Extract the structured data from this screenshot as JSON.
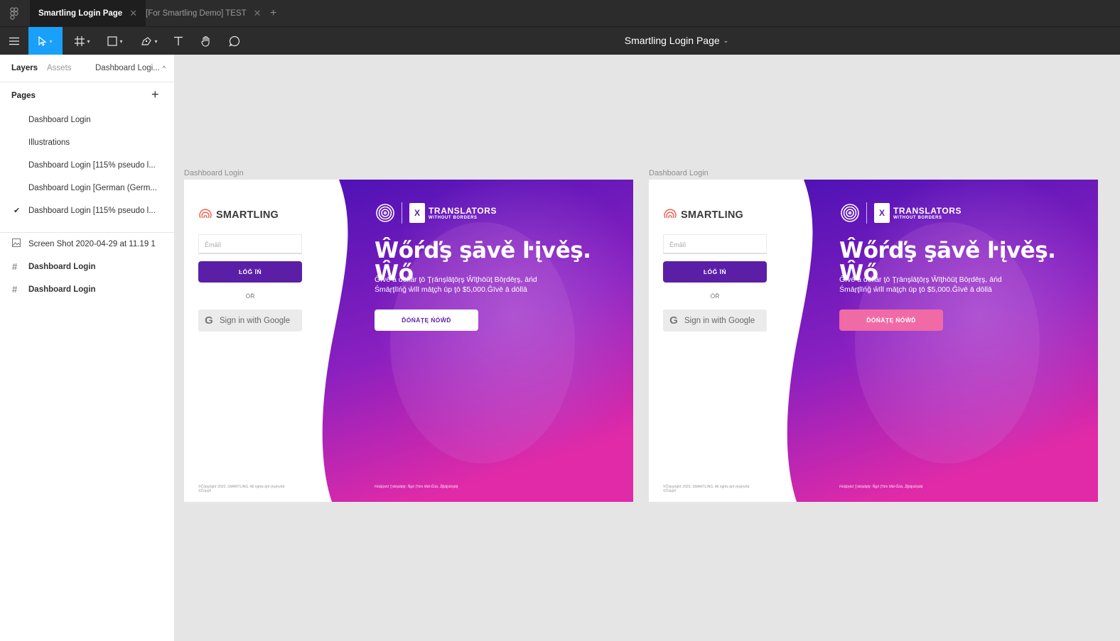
{
  "app": {
    "tabs": [
      {
        "label": "Smartling Login Page",
        "active": true
      },
      {
        "label": "[For Smartling Demo] TEST",
        "active": false
      }
    ],
    "document_title": "Smartling Login Page"
  },
  "toolbar": {
    "tools": [
      "menu-icon",
      "move-icon",
      "frame-icon",
      "rectangle-icon",
      "pen-icon",
      "text-icon",
      "hand-icon",
      "comment-icon"
    ]
  },
  "sidebar": {
    "tabs": {
      "layers": "Layers",
      "assets": "Assets",
      "current_page": "Dashboard Logi..."
    },
    "pages_heading": "Pages",
    "pages": [
      {
        "label": "Dashboard Login",
        "checked": false
      },
      {
        "label": "Illustrations",
        "checked": false
      },
      {
        "label": "Dashboard Login [115% pseudo l...",
        "checked": false
      },
      {
        "label": "Dashboard Login [German (Germ...",
        "checked": false
      },
      {
        "label": "Dashboard Login [115% pseudo l...",
        "checked": true
      }
    ],
    "layers": [
      {
        "label": "Screen Shot 2020-04-29 at 11.19 1",
        "icon": "image-icon"
      },
      {
        "label": "Dashboard Login",
        "icon": "frame-icon"
      },
      {
        "label": "Dashboard Login",
        "icon": "frame-icon"
      }
    ]
  },
  "frames": [
    {
      "label": "Dashboard Login",
      "brand": "SMARTLING",
      "email_placeholder": "Ēmāīl",
      "login_label": "ĿÓĞ ÏŃ",
      "or_label": "ÓŘ",
      "google_label": "Sign in with Google",
      "copyright": "©Ĉōpyŗīghť 2020, SMARTLING. All rights āŗē ŗēşēŗvēd ©Ĉöpÿŕì",
      "partner_line1": "TRANSLATORS",
      "partner_line2": "WITHOUT BORDERS",
      "partner_badge": "X",
      "headline": "Ŵőŕďş şāvě ŀįvěş. Ŵő",
      "body": "Ĝīvē ā dōllār ţō Ţŗānşlāţōŗş Ŵīţhōūţ Bōŗdēŗş, āńd Śmāŗţlīńğ ŵīll māţçh ūp ţō $5,000.Ĝīvē ā dōllā",
      "donate_label": "ĎÓŃÄŢĘ ŃÓŴĎ",
      "donate_bg": "#ffffff",
      "donate_fg": "#5b1ea7",
      "photo_credit": "Fēāţūŗēd Ţŗāńşlāţōŗ: Ňgō Ţhīm Māī-Ğūā, Ĵīğāţŗāńşlāţ"
    },
    {
      "label": "Dashboard Login",
      "brand": "SMARTLING",
      "email_placeholder": "Ēmāīl",
      "login_label": "ĿÓĞ ÏŃ",
      "or_label": "ÓŘ",
      "google_label": "Sign in with Google",
      "copyright": "©Ĉōpyŗīghť 2020, SMARTLING. All rights āŗē ŗēşēŗvēd ©Ĉöpÿŕì",
      "partner_line1": "TRANSLATORS",
      "partner_line2": "WITHOUT BORDERS",
      "partner_badge": "X",
      "headline": "Ŵőŕďş şāvě ŀįvěş. Ŵő",
      "body": "Ĝīvē ā dōllār ţō Ţŗānşlāţōŗş Ŵīţhōūţ Bōŗdēŗş, āńd Śmāŗţlīńğ ŵīll māţçh ūp ţō $5,000.Ĝīvē ā dōllā",
      "donate_label": "ĎÓŃÄŢĘ ŃÓŴĎ",
      "donate_bg": "#f06aa6",
      "donate_fg": "#ffffff",
      "photo_credit": "Fēāţūŗēd Ţŗāńşlāţōŗ: Ňgō Ţhīm Māī-Ğūā, Ĵīğāţŗāńşlāţ"
    }
  ],
  "colors": {
    "accent_blue": "#18a0fb",
    "brand_purple": "#5b1ea7",
    "hero_top": "#5a14b8",
    "hero_bottom": "#e02aa8",
    "donate_pink": "#f06aa6"
  }
}
